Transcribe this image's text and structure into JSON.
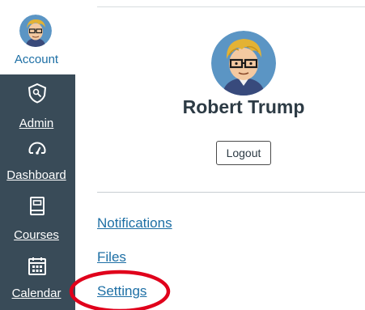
{
  "colors": {
    "nav_background": "#394b58",
    "link": "#1d6fa5",
    "highlight_ring": "#e0001b"
  },
  "nav": {
    "account": {
      "label": "Account",
      "icon": "user-avatar-icon"
    },
    "items": [
      {
        "label": "Admin",
        "icon": "shield-icon"
      },
      {
        "label": "Dashboard",
        "icon": "speedometer-icon"
      },
      {
        "label": "Courses",
        "icon": "book-icon"
      },
      {
        "label": "Calendar",
        "icon": "calendar-icon"
      }
    ]
  },
  "profile": {
    "name": "Robert Trump",
    "logout_label": "Logout",
    "links": [
      {
        "label": "Notifications"
      },
      {
        "label": "Files"
      },
      {
        "label": "Settings"
      }
    ]
  }
}
